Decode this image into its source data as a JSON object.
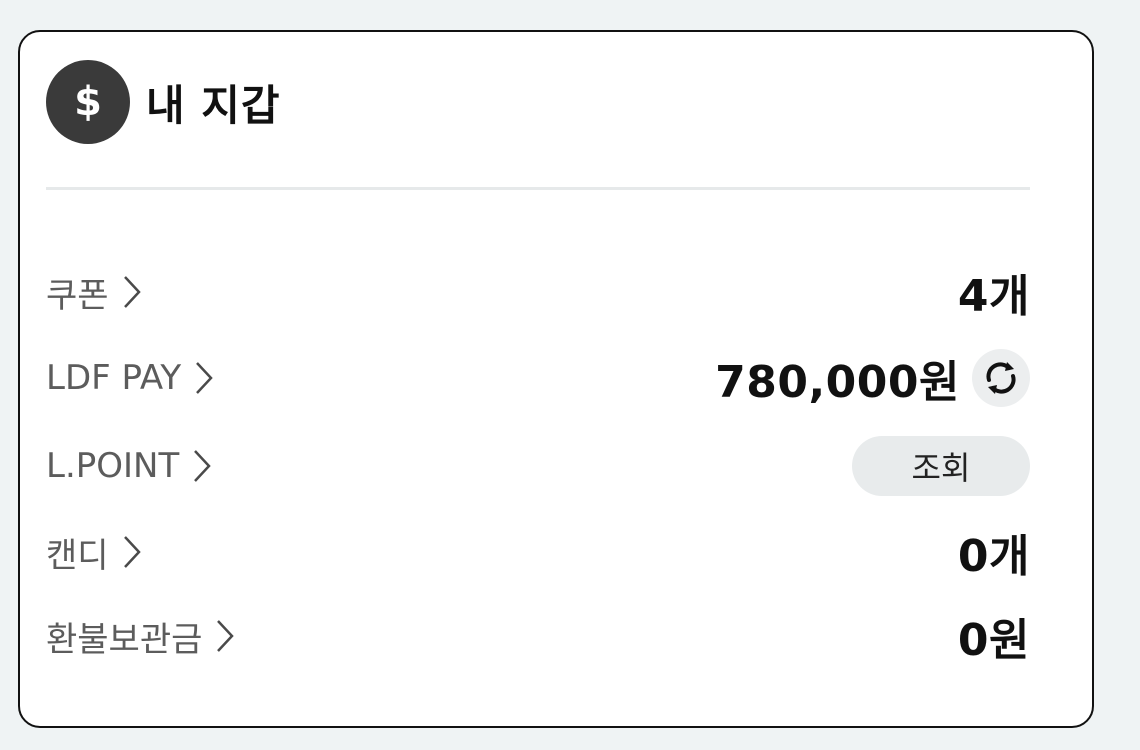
{
  "wallet": {
    "title": "내 지갑",
    "icon": "dollar-coin-icon",
    "icon_symbol": "$",
    "colors": {
      "coin_bg": "#3a3a3a",
      "text_primary": "#111111",
      "text_label": "#5c5c5c",
      "button_bg": "#e8ebec",
      "page_bg": "#eff3f4"
    },
    "items": [
      {
        "label": "쿠폰",
        "value": "4개"
      },
      {
        "label": "LDF PAY",
        "value": "780,000원",
        "action_icon": "refresh-icon"
      },
      {
        "label": "L.POINT",
        "button": "조회"
      },
      {
        "label": "캔디",
        "value": "0개"
      },
      {
        "label": "환불보관금",
        "value": "0원"
      }
    ]
  }
}
